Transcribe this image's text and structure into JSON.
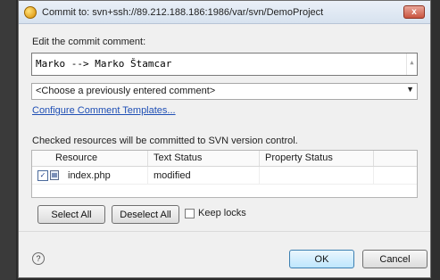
{
  "window": {
    "title": "Commit to: svn+ssh://89.212.188.186:1986/var/svn/DemoProject",
    "close_label": "x"
  },
  "comment": {
    "label": "Edit the commit comment:",
    "value": "Marko --> Marko Štamcar",
    "scroll_glyph": "▲"
  },
  "previous_comment": {
    "selected": "<Choose a previously entered comment>",
    "arrow": "▼"
  },
  "templates_link": "Configure Comment Templates...",
  "resources": {
    "caption": "Checked resources will be committed to SVN version control.",
    "columns": [
      "Resource",
      "Text Status",
      "Property Status",
      ""
    ],
    "rows": [
      {
        "checked": true,
        "check_glyph": "✓",
        "resource": "index.php",
        "text_status": "modified",
        "property_status": ""
      }
    ]
  },
  "buttons": {
    "select_all": "Select All",
    "deselect_all": "Deselect All",
    "keep_locks": "Keep locks",
    "ok": "OK",
    "cancel": "Cancel",
    "help": "?"
  }
}
